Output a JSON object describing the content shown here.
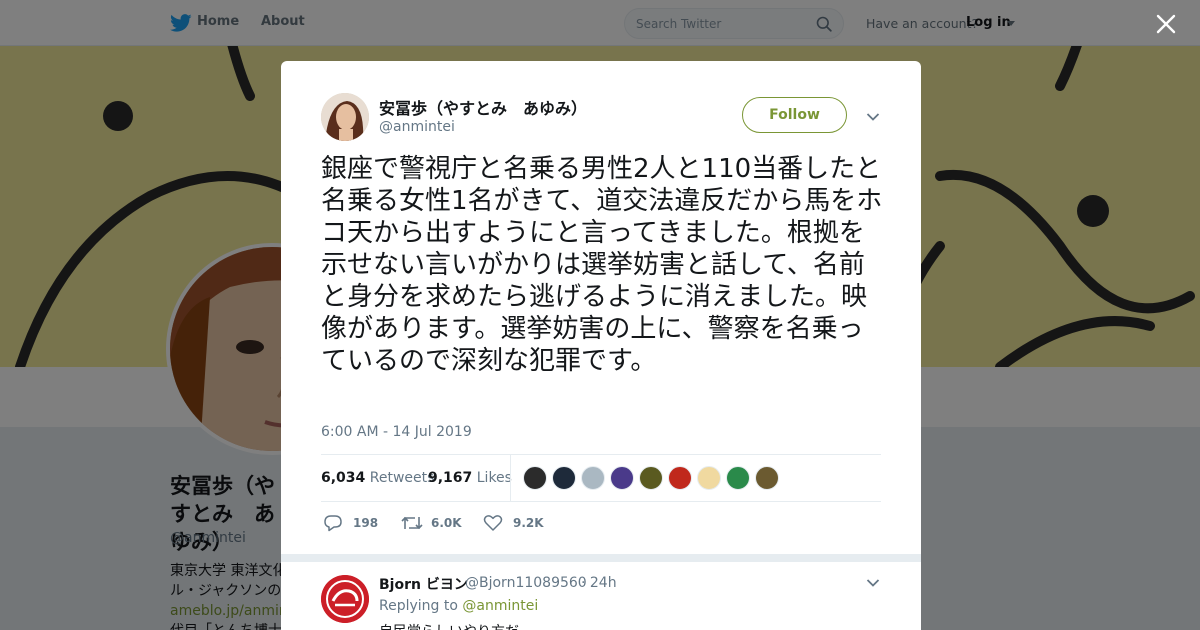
{
  "nav": {
    "home_label": "Home",
    "about_label": "About",
    "search_placeholder": "Search Twitter",
    "have_account": "Have an account?",
    "login_label": "Log in"
  },
  "background_profile": {
    "name": "安冨歩（やすとみ　あゆみ）",
    "handle": "@anmintei",
    "bio_line1": "東京大学 東洋文化",
    "bio_line2": "ル・ジャクソンの",
    "bio_link": "ameblo.jp/anminte",
    "bio_line4": "代目「とんち博士"
  },
  "tweet": {
    "author_name": "安冨歩（やすとみ　あゆみ）",
    "author_handle": "@anmintei",
    "follow_label": "Follow",
    "text": "銀座で警視庁と名乗る男性2人と110当番したと名乗る女性1名がきて、道交法違反だから馬をホコ天から出すようにと言ってきました。根拠を示せない言いがかりは選挙妨害と話して、名前と身分を求めたら逃げるように消えました。映像があります。選挙妨害の上に、警察を名乗っているので深刻な犯罪です。",
    "timestamp": "6:00 AM - 14 Jul 2019",
    "retweet_count": "6,034",
    "retweet_label": "Retweets",
    "like_count": "9,167",
    "like_label": "Likes",
    "reply_action_count": "198",
    "retweet_action_count": "6.0K",
    "like_action_count": "9.2K"
  },
  "likers": [
    {
      "icon": "liker-avatar-1",
      "color": "#2b2b2b"
    },
    {
      "icon": "liker-avatar-2",
      "color": "#1e2a3a"
    },
    {
      "icon": "liker-avatar-3",
      "color": "#aab8c2"
    },
    {
      "icon": "liker-avatar-4",
      "color": "#4a3a8a"
    },
    {
      "icon": "liker-avatar-5",
      "color": "#5a5a20"
    },
    {
      "icon": "liker-avatar-6",
      "color": "#c0281c"
    },
    {
      "icon": "liker-avatar-7",
      "color": "#f0d9a0"
    },
    {
      "icon": "liker-avatar-8",
      "color": "#2a8a4a"
    },
    {
      "icon": "liker-avatar-9",
      "color": "#6b5a30"
    }
  ],
  "reply": {
    "author_name": "Bjorn ビヨン",
    "author_handle": "@Bjorn11089560",
    "time": "· 24h",
    "replying_prefix": "Replying to",
    "replying_to": "@anmintei",
    "text": "自民党らしいやり方だ"
  },
  "colors": {
    "accent": "#7a9635",
    "twitter_blue": "#1da1f2",
    "banner": "#f1e89a"
  }
}
